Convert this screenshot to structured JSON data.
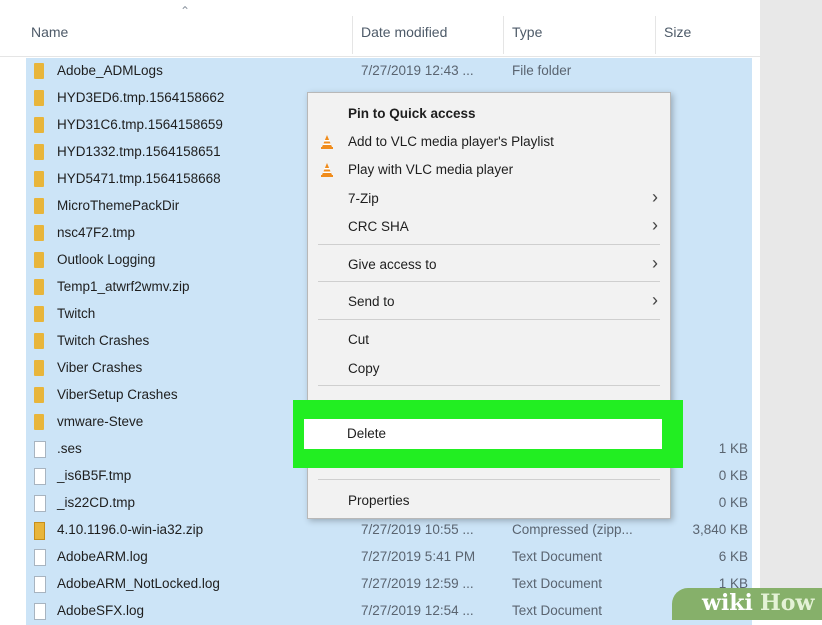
{
  "header": {
    "name": "Name",
    "date_modified": "Date modified",
    "type": "Type",
    "size": "Size"
  },
  "files": [
    {
      "name": "Adobe_ADMLogs",
      "date": "7/27/2019 12:43 ...",
      "type": "File folder",
      "size": "",
      "icon": "folder-icon"
    },
    {
      "name": "HYD3ED6.tmp.1564158662",
      "date": "",
      "type": "",
      "size": "",
      "icon": "folder-icon"
    },
    {
      "name": "HYD31C6.tmp.1564158659",
      "date": "",
      "type": "",
      "size": "",
      "icon": "folder-icon"
    },
    {
      "name": "HYD1332.tmp.1564158651",
      "date": "",
      "type": "",
      "size": "",
      "icon": "folder-icon"
    },
    {
      "name": "HYD5471.tmp.1564158668",
      "date": "",
      "type": "",
      "size": "",
      "icon": "folder-icon"
    },
    {
      "name": "MicroThemePackDir",
      "date": "",
      "type": "",
      "size": "",
      "icon": "folder-icon"
    },
    {
      "name": "nsc47F2.tmp",
      "date": "",
      "type": "",
      "size": "",
      "icon": "folder-icon"
    },
    {
      "name": "Outlook Logging",
      "date": "",
      "type": "",
      "size": "",
      "icon": "folder-icon"
    },
    {
      "name": "Temp1_atwrf2wmv.zip",
      "date": "",
      "type": "",
      "size": "",
      "icon": "folder-icon"
    },
    {
      "name": "Twitch",
      "date": "",
      "type": "",
      "size": "",
      "icon": "folder-icon"
    },
    {
      "name": "Twitch Crashes",
      "date": "",
      "type": "",
      "size": "",
      "icon": "folder-icon"
    },
    {
      "name": "Viber Crashes",
      "date": "",
      "type": "",
      "size": "",
      "icon": "folder-icon"
    },
    {
      "name": "ViberSetup Crashes",
      "date": "",
      "type": "",
      "size": "",
      "icon": "folder-icon"
    },
    {
      "name": "vmware-Steve",
      "date": "",
      "type": "",
      "size": "",
      "icon": "folder-icon"
    },
    {
      "name": ".ses",
      "date": "",
      "type": "",
      "size": "1 KB",
      "icon": "file-icon"
    },
    {
      "name": "_is6B5F.tmp",
      "date": "",
      "type": "",
      "size": "0 KB",
      "icon": "file-icon"
    },
    {
      "name": "_is22CD.tmp",
      "date": "",
      "type": "",
      "size": "0 KB",
      "icon": "file-icon"
    },
    {
      "name": "4.10.1196.0-win-ia32.zip",
      "date": "7/27/2019 10:55 ...",
      "type": "Compressed (zipp...",
      "size": "3,840 KB",
      "icon": "zip-icon"
    },
    {
      "name": "AdobeARM.log",
      "date": "7/27/2019 5:41 PM",
      "type": "Text Document",
      "size": "6 KB",
      "icon": "file-icon"
    },
    {
      "name": "AdobeARM_NotLocked.log",
      "date": "7/27/2019 12:59 ...",
      "type": "Text Document",
      "size": "1 KB",
      "icon": "file-icon"
    },
    {
      "name": "AdobeSFX.log",
      "date": "7/27/2019 12:54 ...",
      "type": "Text Document",
      "size": "",
      "icon": "file-icon"
    }
  ],
  "context_menu": {
    "pin": "Pin to Quick access",
    "vlc_playlist": "Add to VLC media player's Playlist",
    "vlc_play": "Play with VLC media player",
    "seven_zip": "7-Zip",
    "crc_sha": "CRC SHA",
    "give_access": "Give access to",
    "send_to": "Send to",
    "cut": "Cut",
    "copy": "Copy",
    "delete": "Delete",
    "properties": "Properties",
    "submenu_arrow": "›"
  },
  "watermark": {
    "wiki": "wiki",
    "how": "How"
  },
  "colors": {
    "selection": "#cce4f7",
    "highlight": "#22ee22",
    "folder": "#e8b53b",
    "vlc_orange": "#f08c1c",
    "watermark": "#86b06a"
  }
}
